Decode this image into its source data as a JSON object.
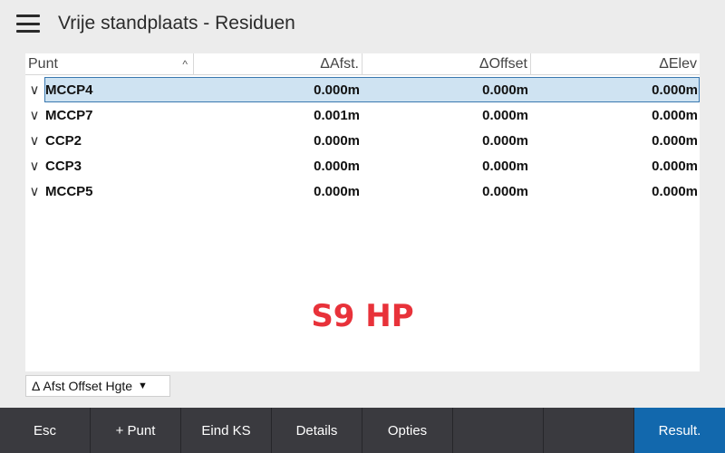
{
  "header": {
    "title": "Vrije standplaats - Residuen",
    "menu_icon": "hamburger-icon"
  },
  "table": {
    "columns": [
      "Punt",
      "ΔAfst.",
      "ΔOffset",
      "ΔElev"
    ],
    "sort_icon": "^",
    "rows": [
      {
        "check": "∨",
        "name": "MCCP4",
        "afst": "0.000m",
        "offset": "0.000m",
        "elev": "0.000m",
        "selected": true
      },
      {
        "check": "∨",
        "name": "MCCP7",
        "afst": "0.001m",
        "offset": "0.000m",
        "elev": "0.000m"
      },
      {
        "check": "∨",
        "name": "CCP2",
        "afst": "0.000m",
        "offset": "0.000m",
        "elev": "0.000m"
      },
      {
        "check": "∨",
        "name": "CCP3",
        "afst": "0.000m",
        "offset": "0.000m",
        "elev": "0.000m"
      },
      {
        "check": "∨",
        "name": "MCCP5",
        "afst": "0.000m",
        "offset": "0.000m",
        "elev": "0.000m"
      }
    ]
  },
  "watermark": "S9 HP",
  "view_select": {
    "value": "Δ Afst Offset Hgte",
    "caret": "▼"
  },
  "toolbar": {
    "buttons": [
      "Esc",
      "+ Punt",
      "Eind KS",
      "Details",
      "Opties",
      "",
      "",
      "Result."
    ]
  },
  "colors": {
    "accent": "#1268ad",
    "selection": "#cfe3f2",
    "watermark": "#e8323a"
  }
}
